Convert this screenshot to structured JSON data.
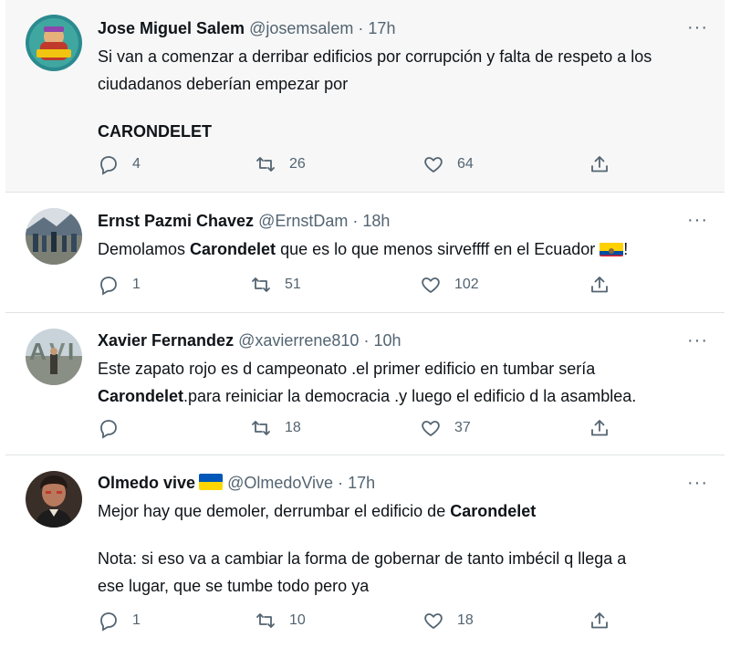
{
  "tweets": [
    {
      "name": "Jose Miguel Salem",
      "handle": "@josemsalem",
      "dot": "·",
      "time": "17h",
      "more": "···",
      "text_line1": "Si van a comenzar a derribar edificios por corrupción y falta de respeto a los",
      "text_line2": "ciudadanos deberían empezar por",
      "text_line3": "CARONDELET",
      "replies": "4",
      "retweets": "26",
      "likes": "64"
    },
    {
      "name": "Ernst Pazmi Chavez",
      "handle": "@ErnstDam",
      "dot": "·",
      "time": "18h",
      "more": "···",
      "text_pre": "Demolamos ",
      "text_bold": "Carondelet",
      "text_post": " que es lo que menos sirveffff en el Ecuador ",
      "text_end": "!",
      "flag": "ecuador-flag",
      "replies": "1",
      "retweets": "51",
      "likes": "102"
    },
    {
      "name": "Xavier Fernandez",
      "handle": "@xavierrene810",
      "dot": "·",
      "time": "10h",
      "more": "···",
      "text_line1": "Este zapato rojo es d campeonato .el primer edificio en tumbar sería",
      "text_bold": "Carondelet",
      "text_line2_rest": ".para reiniciar la democracia .y luego el edificio d la asamblea.",
      "replies": "",
      "retweets": "18",
      "likes": "37"
    },
    {
      "name": "Olmedo vive",
      "flag": "ukraine-flag",
      "handle": "@OlmedoVive",
      "dot": "·",
      "time": "17h",
      "more": "···",
      "text_pre": "Mejor hay que demoler, derrumbar el edificio de ",
      "text_bold": "Carondelet",
      "text_line3": "Nota: si eso va a cambiar la forma de gobernar de tanto imbécil q llega a",
      "text_line4": "ese lugar, que se tumbe todo pero ya",
      "replies": "1",
      "retweets": "10",
      "likes": "18"
    }
  ],
  "colors": {
    "text": "#0f1419",
    "muted": "#536471",
    "highlight_bg": "#f7f7f7",
    "divider": "#dfe3e6"
  },
  "icons": [
    "reply-icon",
    "retweet-icon",
    "like-icon",
    "share-icon",
    "more-icon"
  ]
}
